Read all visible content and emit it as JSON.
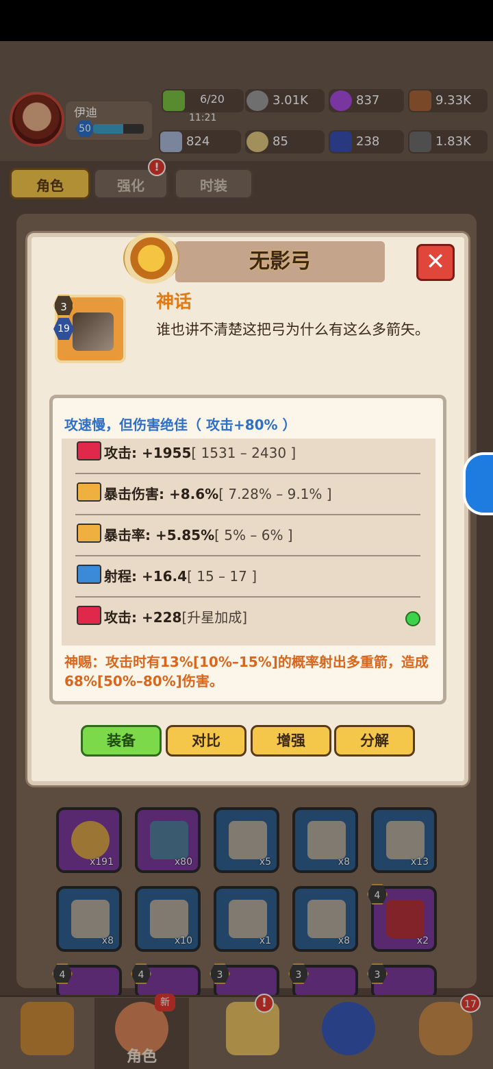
{
  "player": {
    "name": "伊迪",
    "level": "50",
    "xp_fraction": 0.6
  },
  "resources": {
    "energy": {
      "value": "6/20",
      "timer": "11:21"
    },
    "coins": "3.01K",
    "gems": "837",
    "wood": "9.33K",
    "bones": "824",
    "eggs": "85",
    "crystals": "238",
    "stone": "1.83K"
  },
  "tabs": [
    {
      "label": "角色",
      "active": true
    },
    {
      "label": "强化",
      "alert": "!"
    },
    {
      "label": "时装"
    }
  ],
  "modal": {
    "title": "无影弓",
    "close_icon": "close-icon",
    "item_stars": "3",
    "item_level": "19",
    "rarity": "神话",
    "description": "谁也讲不清楚这把弓为什么有这么多箭矢。",
    "stats_heading": "攻速慢，但伤害绝佳（ 攻击+80% ）",
    "stats": [
      {
        "icon": "attack-icon",
        "label": "攻击: +1955",
        "range": "[ 1531 – 2430 ]"
      },
      {
        "icon": "crit-damage-icon",
        "label": "暴击伤害: +8.6%",
        "range": "[ 7.28% – 9.1% ]"
      },
      {
        "icon": "crit-rate-icon",
        "label": "暴击率: +5.85%",
        "range": "[ 5% – 6% ]"
      },
      {
        "icon": "range-icon",
        "label": "射程: +16.4",
        "range": "[ 15 – 17 ]"
      },
      {
        "icon": "attack-icon",
        "label": "攻击: +228",
        "range": "[升星加成]"
      }
    ],
    "blessing": "神赐：攻击时有13%[10%–15%]的概率射出多重箭，造成68%[50%–80%]伤害。",
    "buttons": {
      "equip": "装备",
      "compare": "对比",
      "enhance": "增强",
      "dismantle": "分解"
    }
  },
  "inventory": {
    "row1": [
      {
        "color": "purple",
        "count": "x191"
      },
      {
        "color": "purple",
        "count": "x80"
      },
      {
        "color": "blue",
        "count": "x5"
      },
      {
        "color": "blue",
        "count": "x8"
      },
      {
        "color": "blue",
        "count": "x13"
      }
    ],
    "row2": [
      {
        "color": "blue",
        "count": "x8"
      },
      {
        "color": "blue",
        "count": "x10"
      },
      {
        "color": "blue",
        "count": "x1"
      },
      {
        "color": "blue",
        "count": "x8"
      },
      {
        "color": "purple",
        "count": "x2",
        "stars": "4"
      }
    ],
    "row3_stars": [
      "4",
      "4",
      "3",
      "3",
      "3"
    ]
  },
  "bottom_nav": {
    "hero_label": "角色",
    "new_badge": "新",
    "map_alert": "!",
    "pet_badge": "17"
  },
  "colors": {
    "accent_yellow": "#f4c64a",
    "rarity_orange": "#e07a14",
    "stat_blue": "#2e6fc8",
    "equip_green": "#7bd94a"
  }
}
